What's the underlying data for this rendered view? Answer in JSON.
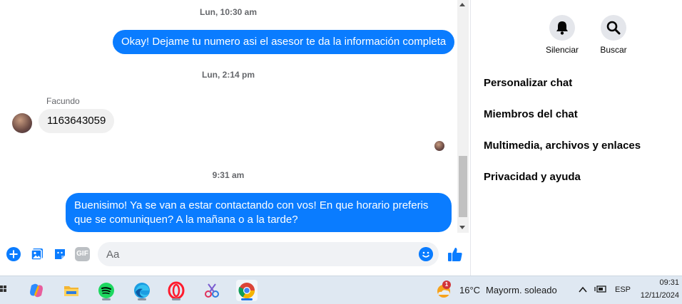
{
  "chat": {
    "messages": [
      {
        "type": "timestamp",
        "text": "Lun, 10:30 am"
      },
      {
        "type": "outgoing",
        "text": "Okay! Dejame tu numero asi el asesor te da la información completa"
      },
      {
        "type": "timestamp",
        "text": "Lun, 2:14 pm"
      },
      {
        "type": "sender",
        "text": "Facundo"
      },
      {
        "type": "incoming",
        "text": "1163643059"
      },
      {
        "type": "timestamp",
        "text": "9:31 am"
      },
      {
        "type": "outgoing",
        "text": "Buenisimo! Ya se van a estar contactando con vos! En que horario preferis que se comuniquen? A la mañana o a la tarde?"
      }
    ],
    "input_placeholder": "Aa",
    "gif_label": "GIF"
  },
  "side_panel": {
    "actions": [
      {
        "label": "Silenciar",
        "icon": "bell-icon"
      },
      {
        "label": "Buscar",
        "icon": "search-icon"
      }
    ],
    "menu": [
      "Personalizar chat",
      "Miembros del chat",
      "Multimedia, archivos y enlaces",
      "Privacidad y ayuda"
    ]
  },
  "taskbar": {
    "apps": [
      "copilot-icon",
      "file-explorer-icon",
      "spotify-icon",
      "edge-icon",
      "opera-icon",
      "snipping-tool-icon",
      "chrome-icon"
    ],
    "weather_temp": "16°C",
    "weather_text": "Mayorm. soleado",
    "weather_badge": "1",
    "language": "ESP",
    "time": "09:31",
    "date": "12/11/2024"
  },
  "colors": {
    "accent": "#0a7cff",
    "bubble_in": "#f0f0f0"
  }
}
